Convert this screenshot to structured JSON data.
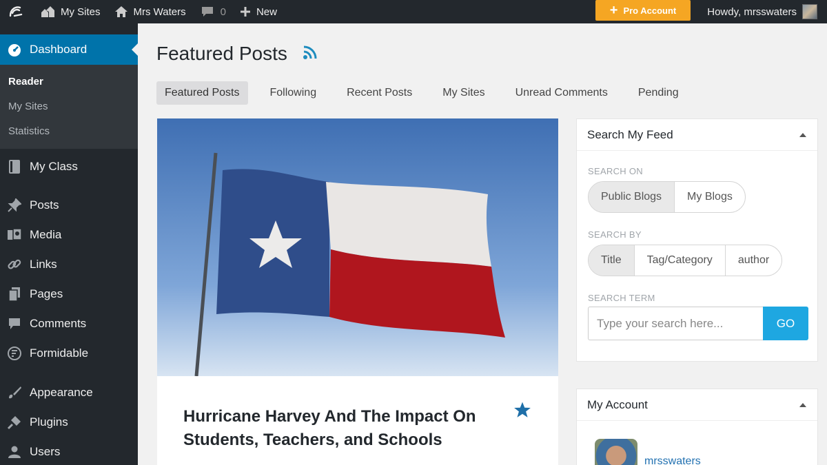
{
  "adminbar": {
    "my_sites": "My Sites",
    "site_name": "Mrs Waters",
    "comment_count": "0",
    "new_label": "New",
    "pro_account": "Pro Account",
    "howdy": "Howdy, mrsswaters"
  },
  "sidebar": {
    "dashboard": "Dashboard",
    "submenu": [
      "Reader",
      "My Sites",
      "Statistics"
    ],
    "items": [
      "My Class",
      "Posts",
      "Media",
      "Links",
      "Pages",
      "Comments",
      "Formidable",
      "Appearance",
      "Plugins",
      "Users"
    ]
  },
  "main": {
    "title": "Featured Posts",
    "tabs": [
      "Featured Posts",
      "Following",
      "Recent Posts",
      "My Sites",
      "Unread Comments",
      "Pending"
    ],
    "active_tab": "Featured Posts",
    "post": {
      "title": "Hurricane Harvey And The Impact On Students, Teachers, and Schools"
    }
  },
  "search_widget": {
    "title": "Search My Feed",
    "search_on_label": "SEARCH ON",
    "search_on_options": [
      "Public Blogs",
      "My Blogs"
    ],
    "search_by_label": "SEARCH BY",
    "search_by_options": [
      "Title",
      "Tag/Category",
      "author"
    ],
    "search_term_label": "SEARCH TERM",
    "placeholder": "Type your search here...",
    "go": "GO"
  },
  "account_widget": {
    "title": "My Account",
    "username": "mrsswaters"
  },
  "colors": {
    "admin_dark": "#23282d",
    "accent_blue": "#0073aa",
    "pro_orange": "#f5a623",
    "go_blue": "#1ea7e1"
  }
}
